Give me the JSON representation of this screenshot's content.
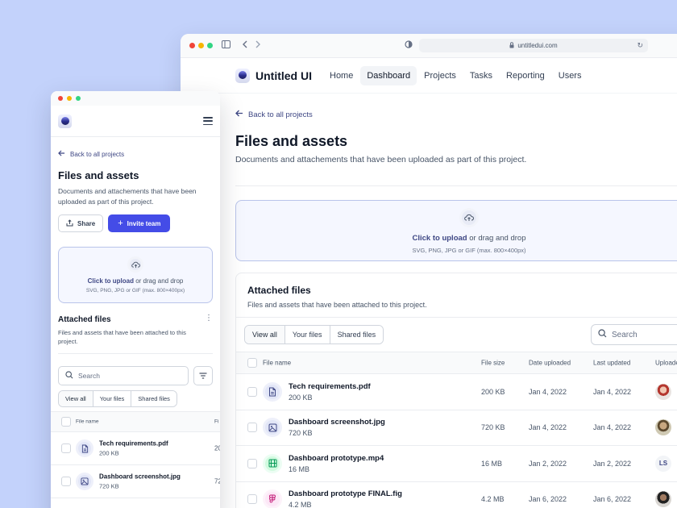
{
  "browser": {
    "url": "untitledui.com"
  },
  "nav": {
    "brand": "Untitled UI",
    "items": [
      {
        "label": "Home",
        "active": false
      },
      {
        "label": "Dashboard",
        "active": true
      },
      {
        "label": "Projects",
        "active": false
      },
      {
        "label": "Tasks",
        "active": false
      },
      {
        "label": "Reporting",
        "active": false
      },
      {
        "label": "Users",
        "active": false
      }
    ]
  },
  "page": {
    "back_label": "Back to all projects",
    "title": "Files and assets",
    "subtitle": "Documents and attachements that have been uploaded as part of this project.",
    "mobile_subtitle": "Documents and attachements that have been uploaded as part of this project."
  },
  "actions": {
    "share_label": "Share",
    "invite_label": "Invite team"
  },
  "upload": {
    "link_text": "Click to upload",
    "rest_text": " or drag and drop",
    "hint": "SVG, PNG, JPG or GIF (max. 800×400px)"
  },
  "attached": {
    "title": "Attached files",
    "subtitle": "Files and assets that have been attached to this project.",
    "tabs": [
      "View all",
      "Your files",
      "Shared files"
    ],
    "search_placeholder": "Search"
  },
  "table": {
    "columns": [
      "File name",
      "File size",
      "Date uploaded",
      "Last updated",
      "Uploade"
    ],
    "mobile_trunc_col": "Fi",
    "rows": [
      {
        "name": "Tech requirements.pdf",
        "size": "200 KB",
        "uploaded": "Jan 4, 2022",
        "updated": "Jan 4, 2022",
        "icon": "file-doc-icon",
        "uploader": "",
        "mobile_trunc": "20"
      },
      {
        "name": "Dashboard screenshot.jpg",
        "size": "720 KB",
        "uploaded": "Jan 4, 2022",
        "updated": "Jan 4, 2022",
        "icon": "image-icon",
        "uploader": "",
        "mobile_trunc": "72"
      },
      {
        "name": "Dashboard prototype.mp4",
        "size": "16 MB",
        "uploaded": "Jan 2, 2022",
        "updated": "Jan 2, 2022",
        "icon": "film-icon",
        "uploader": "LS"
      },
      {
        "name": "Dashboard prototype FINAL.fig",
        "size": "4.2 MB",
        "uploaded": "Jan 6, 2022",
        "updated": "Jan 6, 2022",
        "icon": "figma-icon",
        "uploader": ""
      }
    ]
  },
  "colors": {
    "accent": "#444ce7",
    "link": "#3e4784",
    "background": "#c3d2fb"
  }
}
